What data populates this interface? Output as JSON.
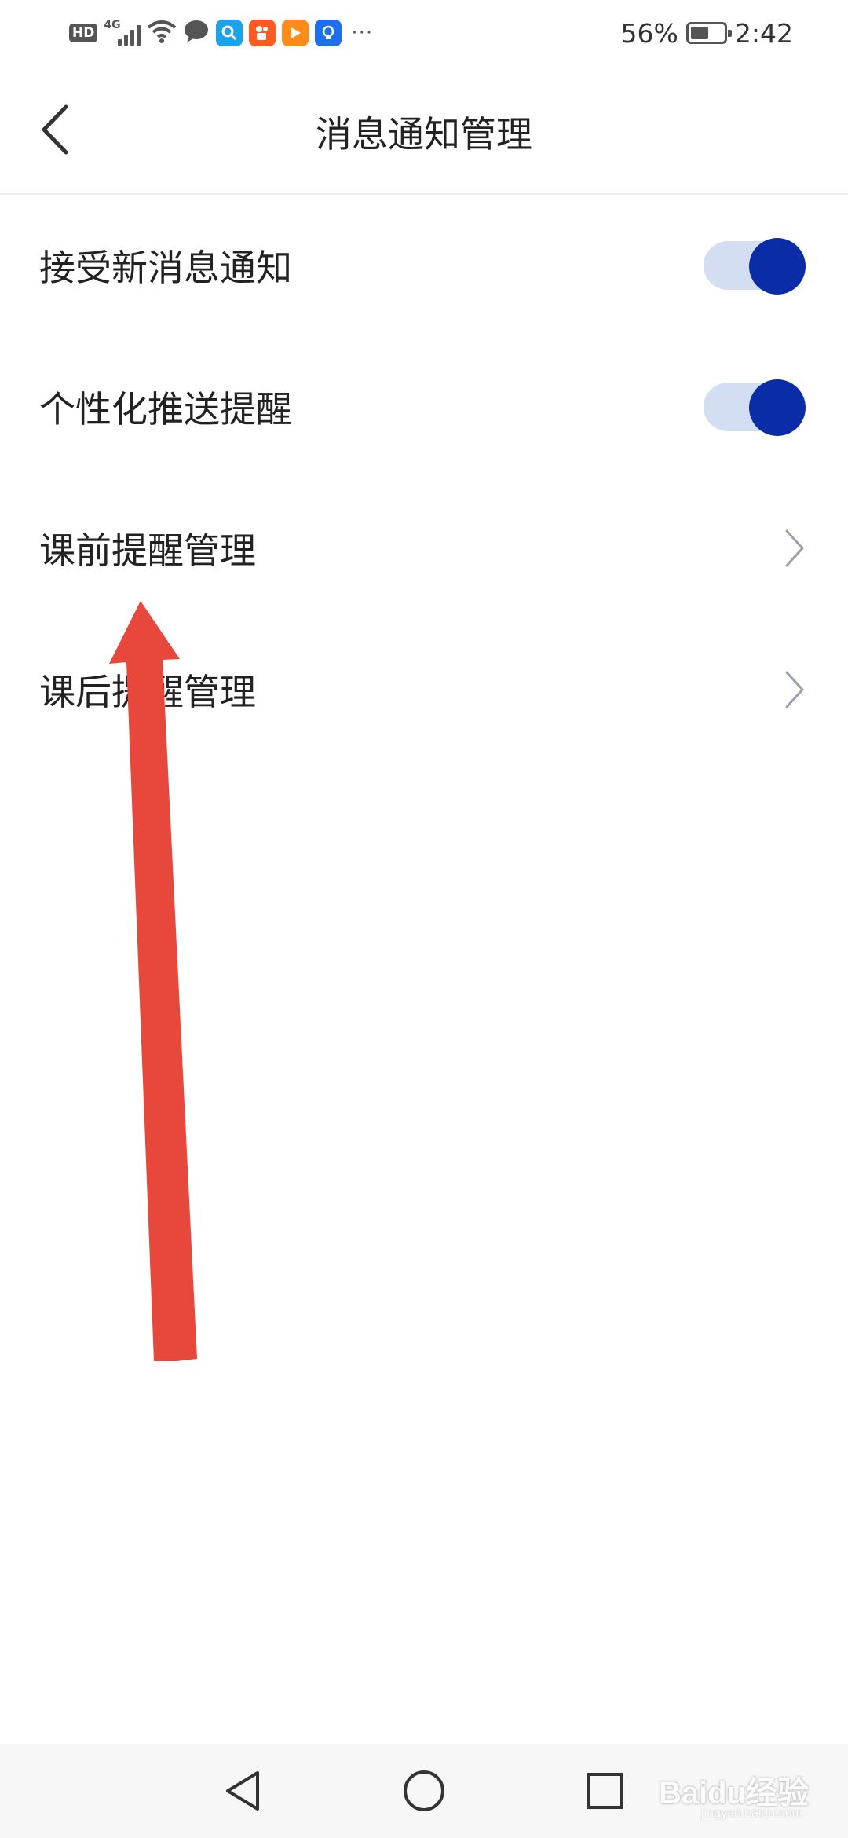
{
  "status_bar": {
    "battery_text": "56%",
    "battery_level": 0.56,
    "time": "2:42",
    "network_badge": "HD",
    "network_type": "4G",
    "icons": [
      "hd-icon",
      "signal-icon",
      "wifi-icon",
      "chat-icon",
      "search-app-icon",
      "kuaishou-app-icon",
      "video-app-icon",
      "bulb-app-icon",
      "more-icon"
    ]
  },
  "header": {
    "title": "消息通知管理",
    "back_icon": "chevron-left-icon"
  },
  "settings": [
    {
      "label": "接受新消息通知",
      "control": "toggle",
      "on": true
    },
    {
      "label": "个性化推送提醒",
      "control": "toggle",
      "on": true
    },
    {
      "label": "课前提醒管理",
      "control": "chevron"
    },
    {
      "label": "课后提醒管理",
      "control": "chevron"
    }
  ],
  "colors": {
    "toggle_on": "#0a2ca6",
    "toggle_track": "#d4def3",
    "annotation_arrow": "#e8483b"
  },
  "nav_bar": {
    "icons": [
      "back-triangle-icon",
      "home-circle-icon",
      "recents-square-icon"
    ]
  },
  "watermark": {
    "text": "Baidu经验",
    "subtext": "jingyan.baidu.com"
  }
}
